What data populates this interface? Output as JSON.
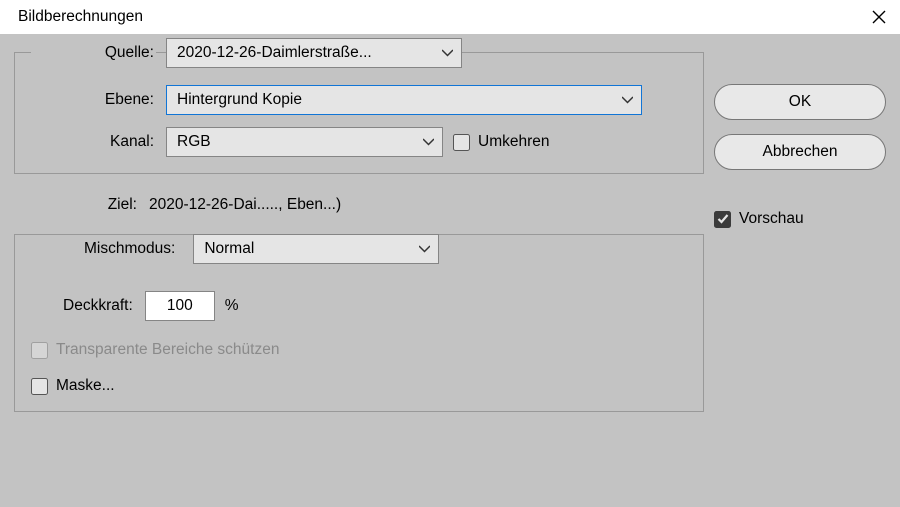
{
  "title": "Bildberechnungen",
  "labels": {
    "source": "Quelle:",
    "layer": "Ebene:",
    "channel": "Kanal:",
    "invert": "Umkehren",
    "target": "Ziel:",
    "blend": "Mischmodus:",
    "opacity": "Deckkraft:",
    "percent": "%",
    "preserve_transparency": "Transparente Bereiche schützen",
    "mask": "Maske..."
  },
  "values": {
    "source": "2020-12-26-Daimlerstraße...",
    "layer": "Hintergrund Kopie",
    "channel": "RGB",
    "target": "2020-12-26-Dai....., Eben...)",
    "blend": "Normal",
    "opacity": "100"
  },
  "buttons": {
    "ok": "OK",
    "cancel": "Abbrechen"
  },
  "preview_label": "Vorschau",
  "preview_checked": true
}
